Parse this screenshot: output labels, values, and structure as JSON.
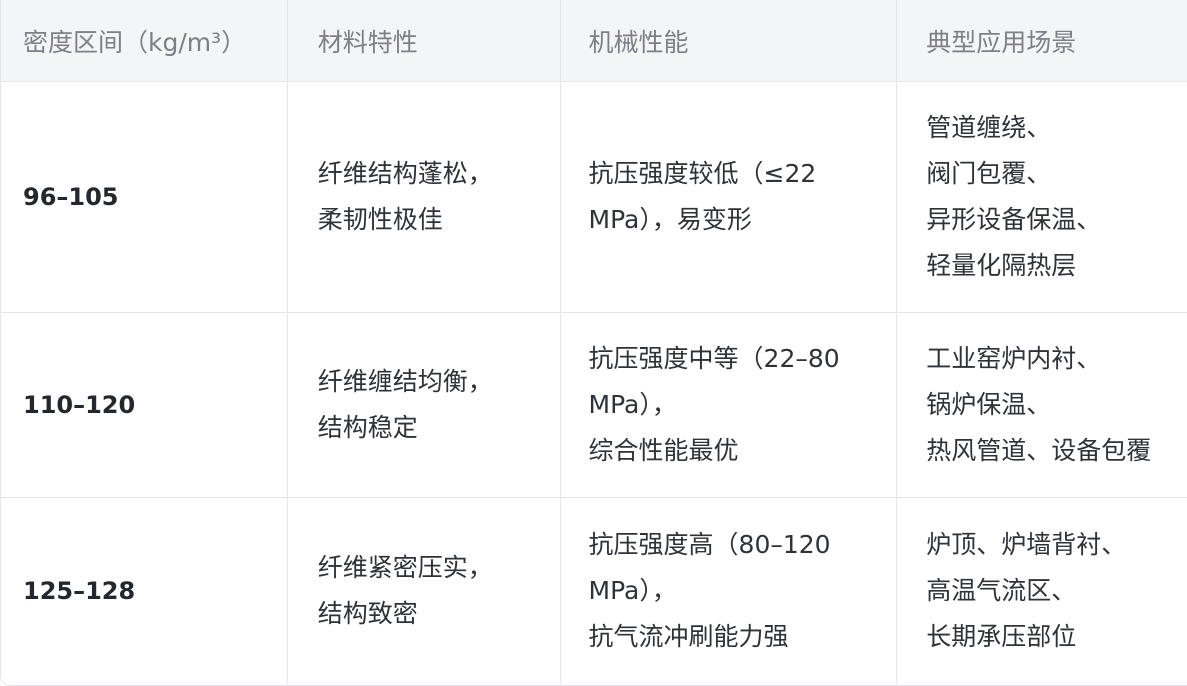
{
  "table": {
    "headers": [
      "密度区间（kg/m³）",
      "材料特性",
      "机械性能",
      "典型应用场景"
    ],
    "rows": [
      {
        "density": "96–105",
        "properties": [
          "纤维结构蓬松，",
          "柔韧性极佳"
        ],
        "mechanical": [
          "抗压强度较低（≤22",
          "MPa），易变形"
        ],
        "applications": [
          "管道缠绕、",
          "阀门包覆、",
          "异形设备保温、",
          "轻量化隔热层"
        ]
      },
      {
        "density": "110–120",
        "properties": [
          "纤维缠结均衡，",
          "结构稳定"
        ],
        "mechanical": [
          "抗压强度中等（22–80",
          "MPa），",
          "综合性能最优"
        ],
        "applications": [
          "工业窑炉内衬、",
          "锅炉保温、",
          "热风管道、设备包覆"
        ]
      },
      {
        "density": "125–128",
        "properties": [
          "纤维紧密压实，",
          "结构致密"
        ],
        "mechanical": [
          "抗压强度高（80–120",
          "MPa），",
          "抗气流冲刷能力强"
        ],
        "applications": [
          "炉顶、炉墙背衬、",
          "高温气流区、",
          "长期承压部位"
        ]
      }
    ]
  }
}
